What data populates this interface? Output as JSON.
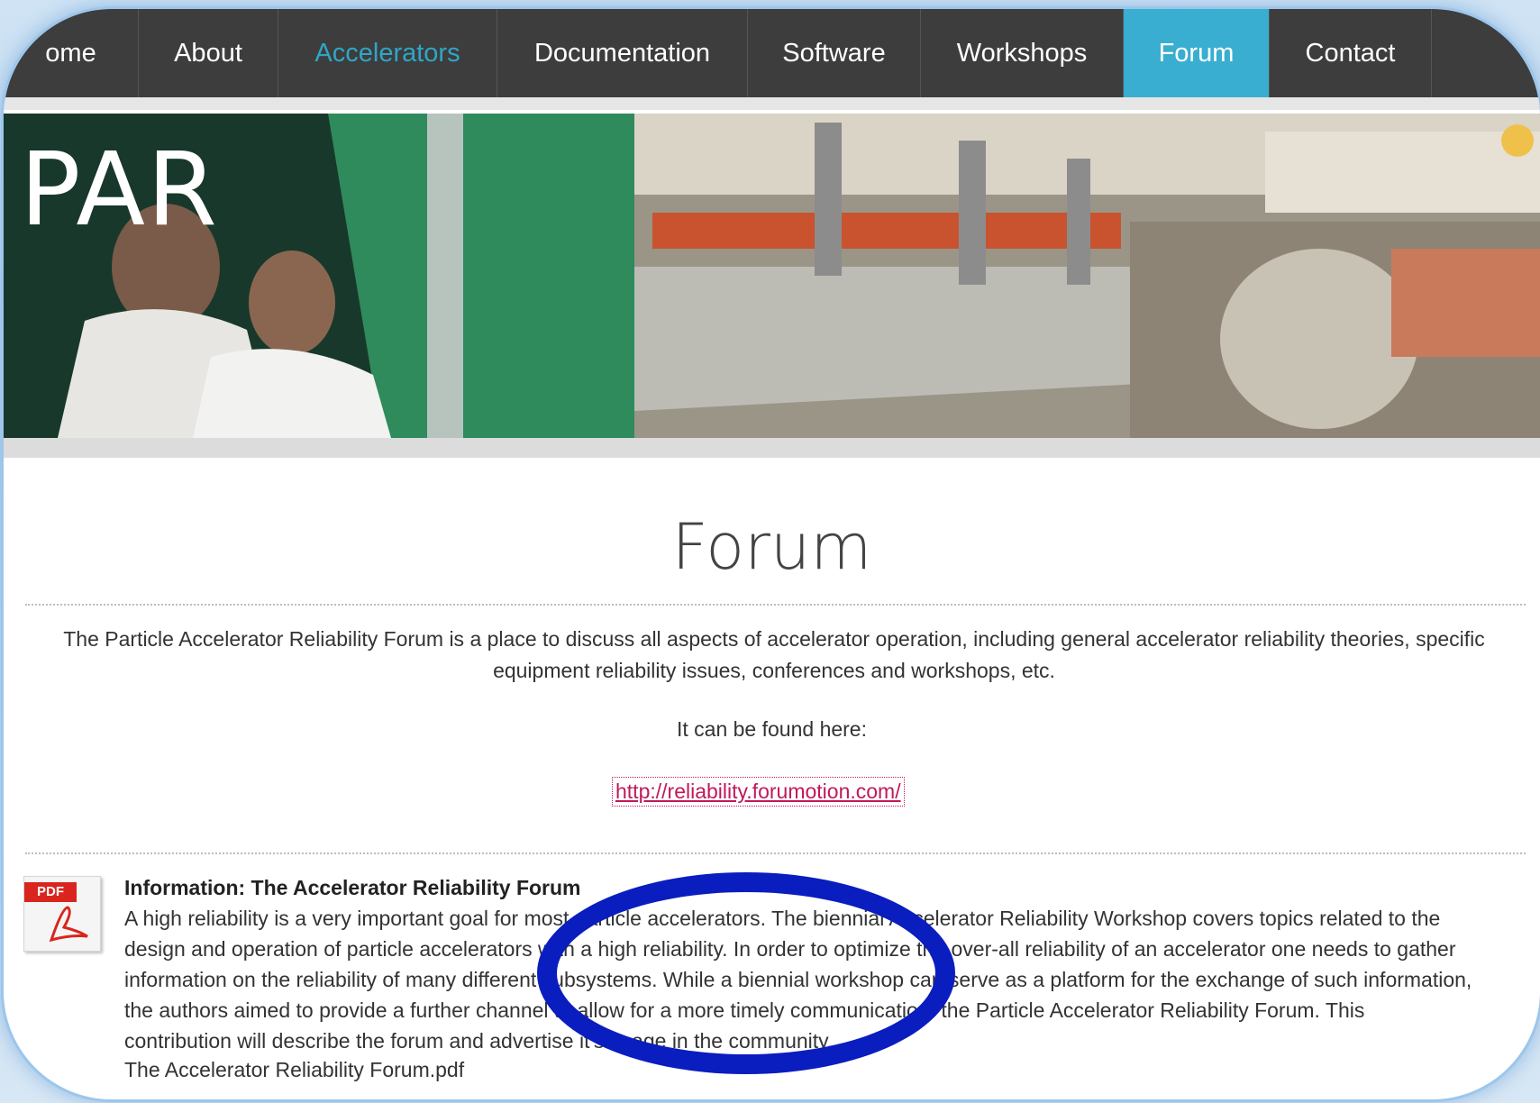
{
  "nav": {
    "items": [
      {
        "label": "ome",
        "width": 150
      },
      {
        "label": "About",
        "width": 155
      },
      {
        "label": "Accelerators",
        "width": 243,
        "accent": true
      },
      {
        "label": "Documentation",
        "width": 278
      },
      {
        "label": "Software",
        "width": 192
      },
      {
        "label": "Workshops",
        "width": 225
      },
      {
        "label": "Forum",
        "width": 162,
        "active": true
      },
      {
        "label": "Contact",
        "width": 180
      }
    ],
    "accent_color": "#2fa6c7",
    "active_color": "#3aaed0"
  },
  "banner": {
    "logo_text": "PAR"
  },
  "page": {
    "title": "Forum",
    "intro": "The Particle Accelerator Reliability Forum is a place to discuss all aspects of accelerator operation, including general accelerator reliability theories, specific equipment reliability issues, conferences and workshops, etc.",
    "found_here": "It can be found here:",
    "link": "http://reliability.forumotion.com/"
  },
  "info": {
    "badge": "PDF",
    "title": "Information: The Accelerator Reliability Forum",
    "body": "A high reliability is a very important goal for most particle accelerators. The biennial Accelerator Reliability Workshop covers topics related to the design and operation of particle accelerators with a high reliability. In order to optimize the over-all reliability of an accelerator one needs to gather information on the reliability of many different subsystems. While a biennial workshop can serve as a platform for the exchange of such information, the authors aimed to provide a further channel to allow for a more timely communication: the Particle Accelerator Reliability Forum. This contribution will describe the forum and advertise it's usage in the community.",
    "file": "The Accelerator Reliability Forum.pdf"
  },
  "annotation": {
    "color": "#0a1dbf"
  }
}
